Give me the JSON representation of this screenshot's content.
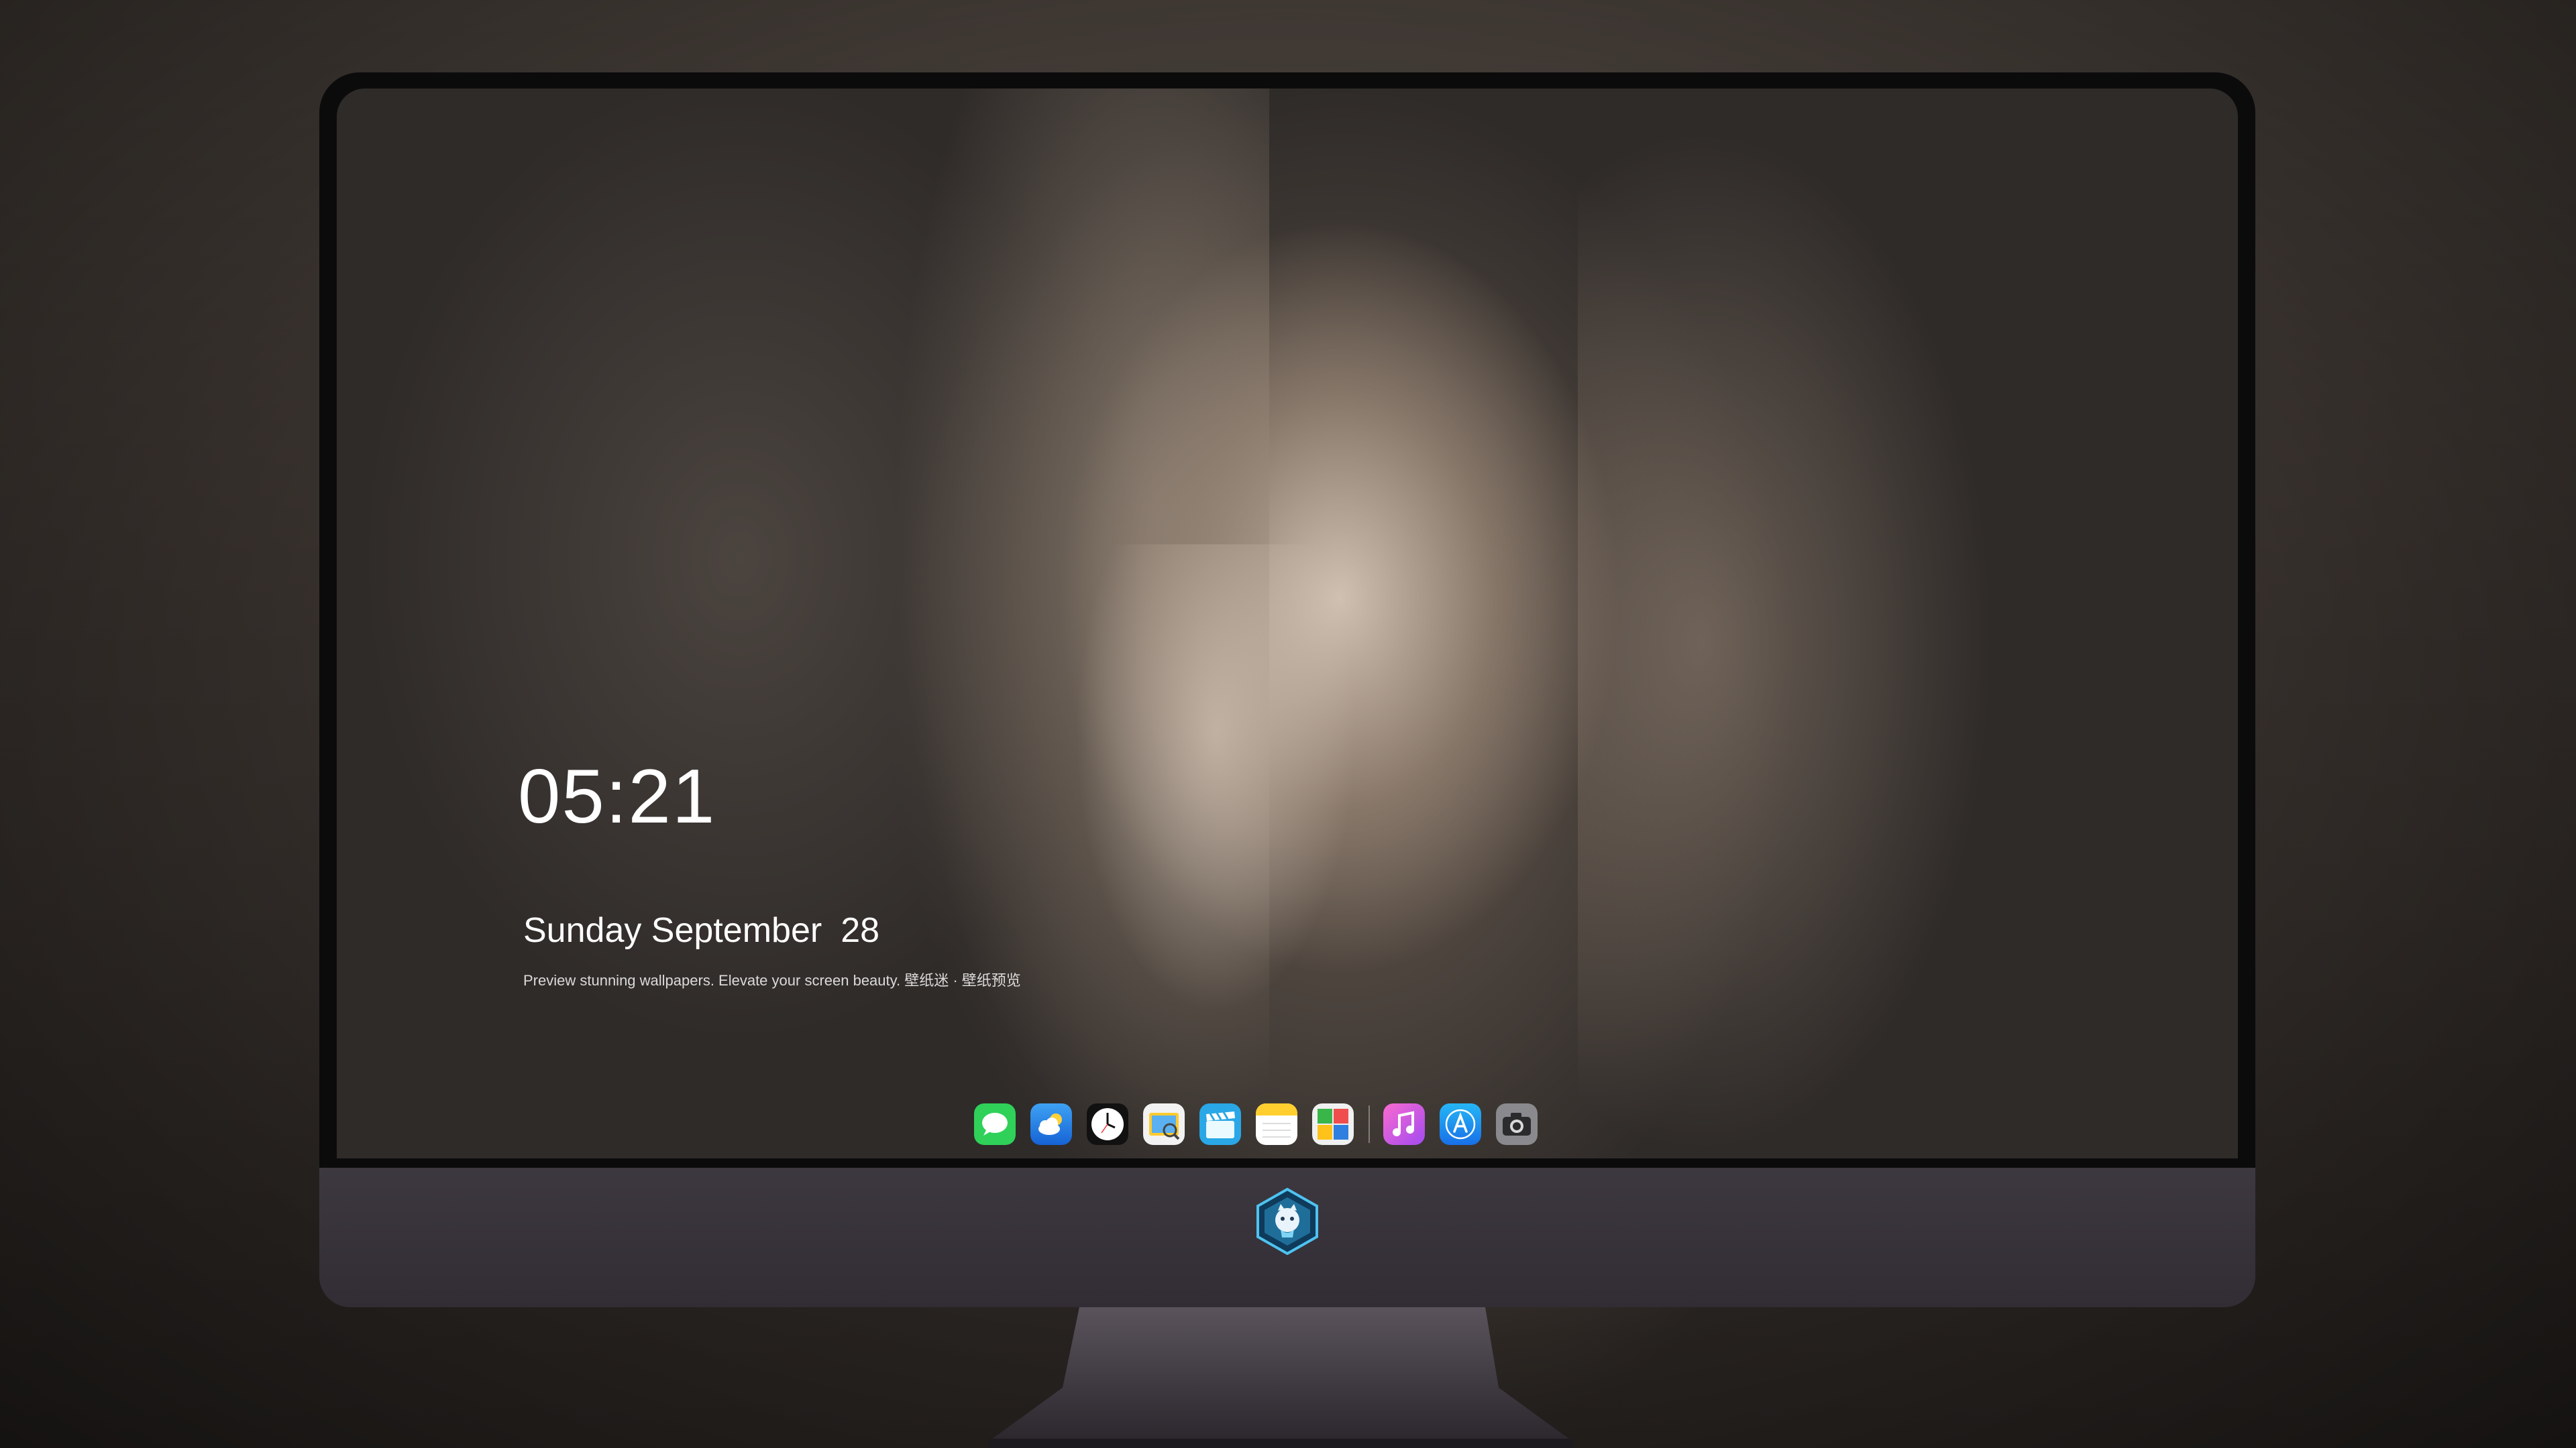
{
  "lockscreen": {
    "time": "05:21",
    "date": "Sunday September",
    "day": "28",
    "tagline": "Preview stunning wallpapers. Elevate your screen beauty. 壁纸迷 · 壁纸预览"
  },
  "dock": {
    "apps": [
      {
        "name": "Messages",
        "icon": "messages-icon"
      },
      {
        "name": "Weather",
        "icon": "weather-icon"
      },
      {
        "name": "Clock",
        "icon": "clock-icon"
      },
      {
        "name": "Preview",
        "icon": "preview-icon"
      },
      {
        "name": "Clips",
        "icon": "clapperboard-icon"
      },
      {
        "name": "Notes",
        "icon": "notes-icon"
      },
      {
        "name": "Photo Booth",
        "icon": "photo-booth-icon"
      },
      {
        "name": "iTunes",
        "icon": "music-icon"
      },
      {
        "name": "App Store",
        "icon": "app-store-icon"
      },
      {
        "name": "Camera",
        "icon": "camera-icon"
      }
    ]
  },
  "colors": {
    "bezel": "#0c0b0c",
    "chin": "#3d3840",
    "text": "#ffffff"
  }
}
